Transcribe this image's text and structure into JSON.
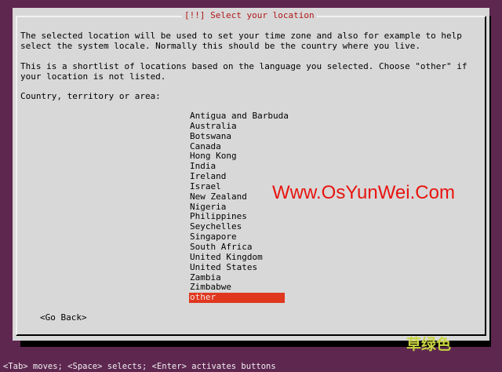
{
  "dialog": {
    "title": "[!!] Select your location",
    "para1": "The selected location will be used to set your time zone and also for example to help\nselect the system locale. Normally this should be the country where you live.",
    "para2": "This is a shortlist of locations based on the language you selected. Choose \"other\" if\nyour location is not listed.",
    "prompt": "Country, territory or area:",
    "countries": [
      "Antigua and Barbuda",
      "Australia",
      "Botswana",
      "Canada",
      "Hong Kong",
      "India",
      "Ireland",
      "Israel",
      "New Zealand",
      "Nigeria",
      "Philippines",
      "Seychelles",
      "Singapore",
      "South Africa",
      "United Kingdom",
      "United States",
      "Zambia",
      "Zimbabwe",
      "other"
    ],
    "selected_country": "other",
    "go_back_label": "<Go Back>"
  },
  "watermark": {
    "site": "Www.OsYunWei.Com",
    "tag": "草绿色"
  },
  "statusbar": {
    "text": "<Tab> moves; <Space> selects; <Enter> activates buttons"
  },
  "colors": {
    "background": "#5e2750",
    "dialog": "#d8d8d8",
    "title": "#b01818",
    "selection": "#e0371f",
    "watermark": "#e8140f",
    "watermark_tag": "#c8d440"
  }
}
